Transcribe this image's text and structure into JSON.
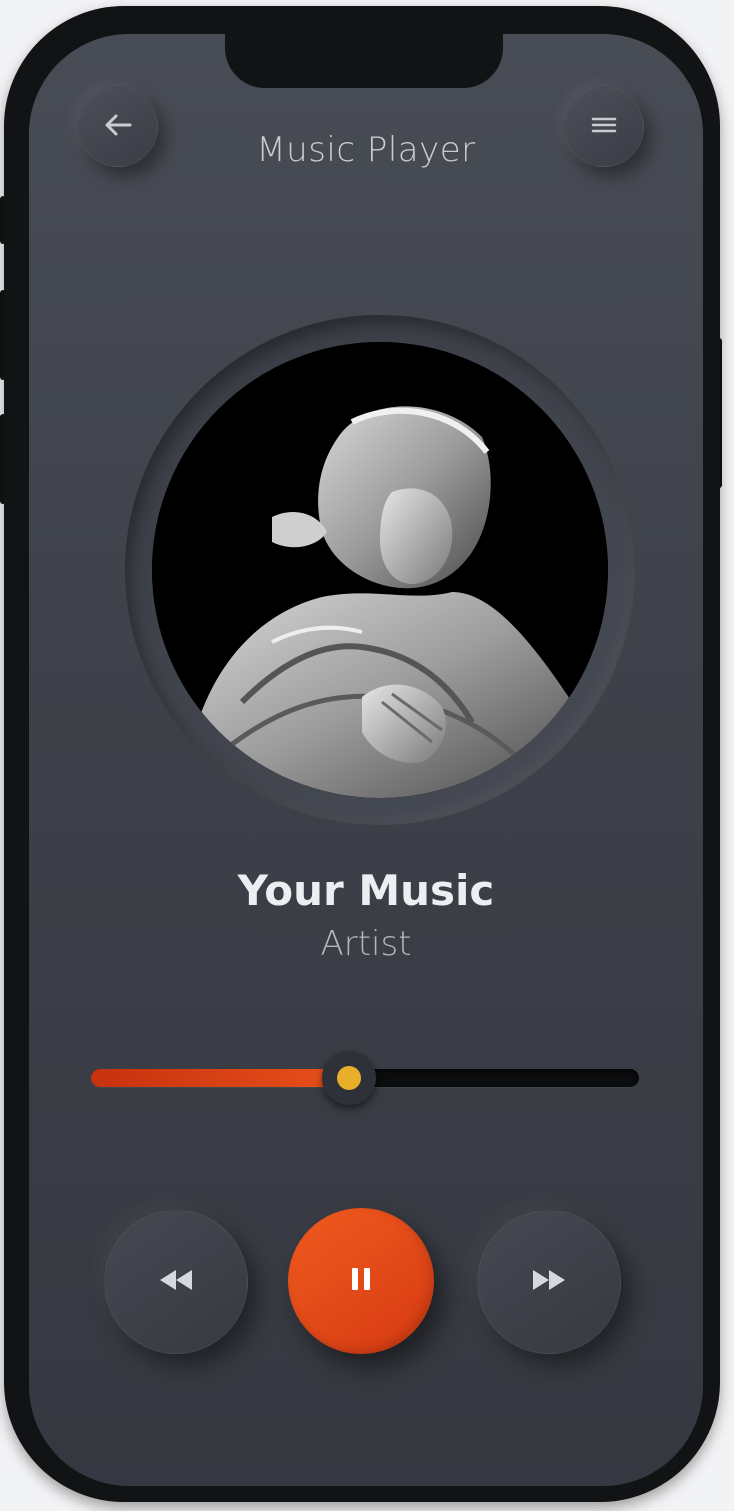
{
  "header": {
    "title": "Music Player",
    "back_icon": "arrow-left-icon",
    "menu_icon": "hamburger-menu-icon"
  },
  "album_art": {
    "description_icon": "statue-artwork"
  },
  "track": {
    "title": "Your Music",
    "artist": "Artist"
  },
  "progress": {
    "fraction": 0.47
  },
  "controls": {
    "rewind_icon": "rewind-icon",
    "pause_icon": "pause-icon",
    "forward_icon": "fast-forward-icon"
  },
  "colors": {
    "accent": "#e8511a",
    "knob": "#e8b02a",
    "background": "#3e4149",
    "frame": "#121314"
  }
}
